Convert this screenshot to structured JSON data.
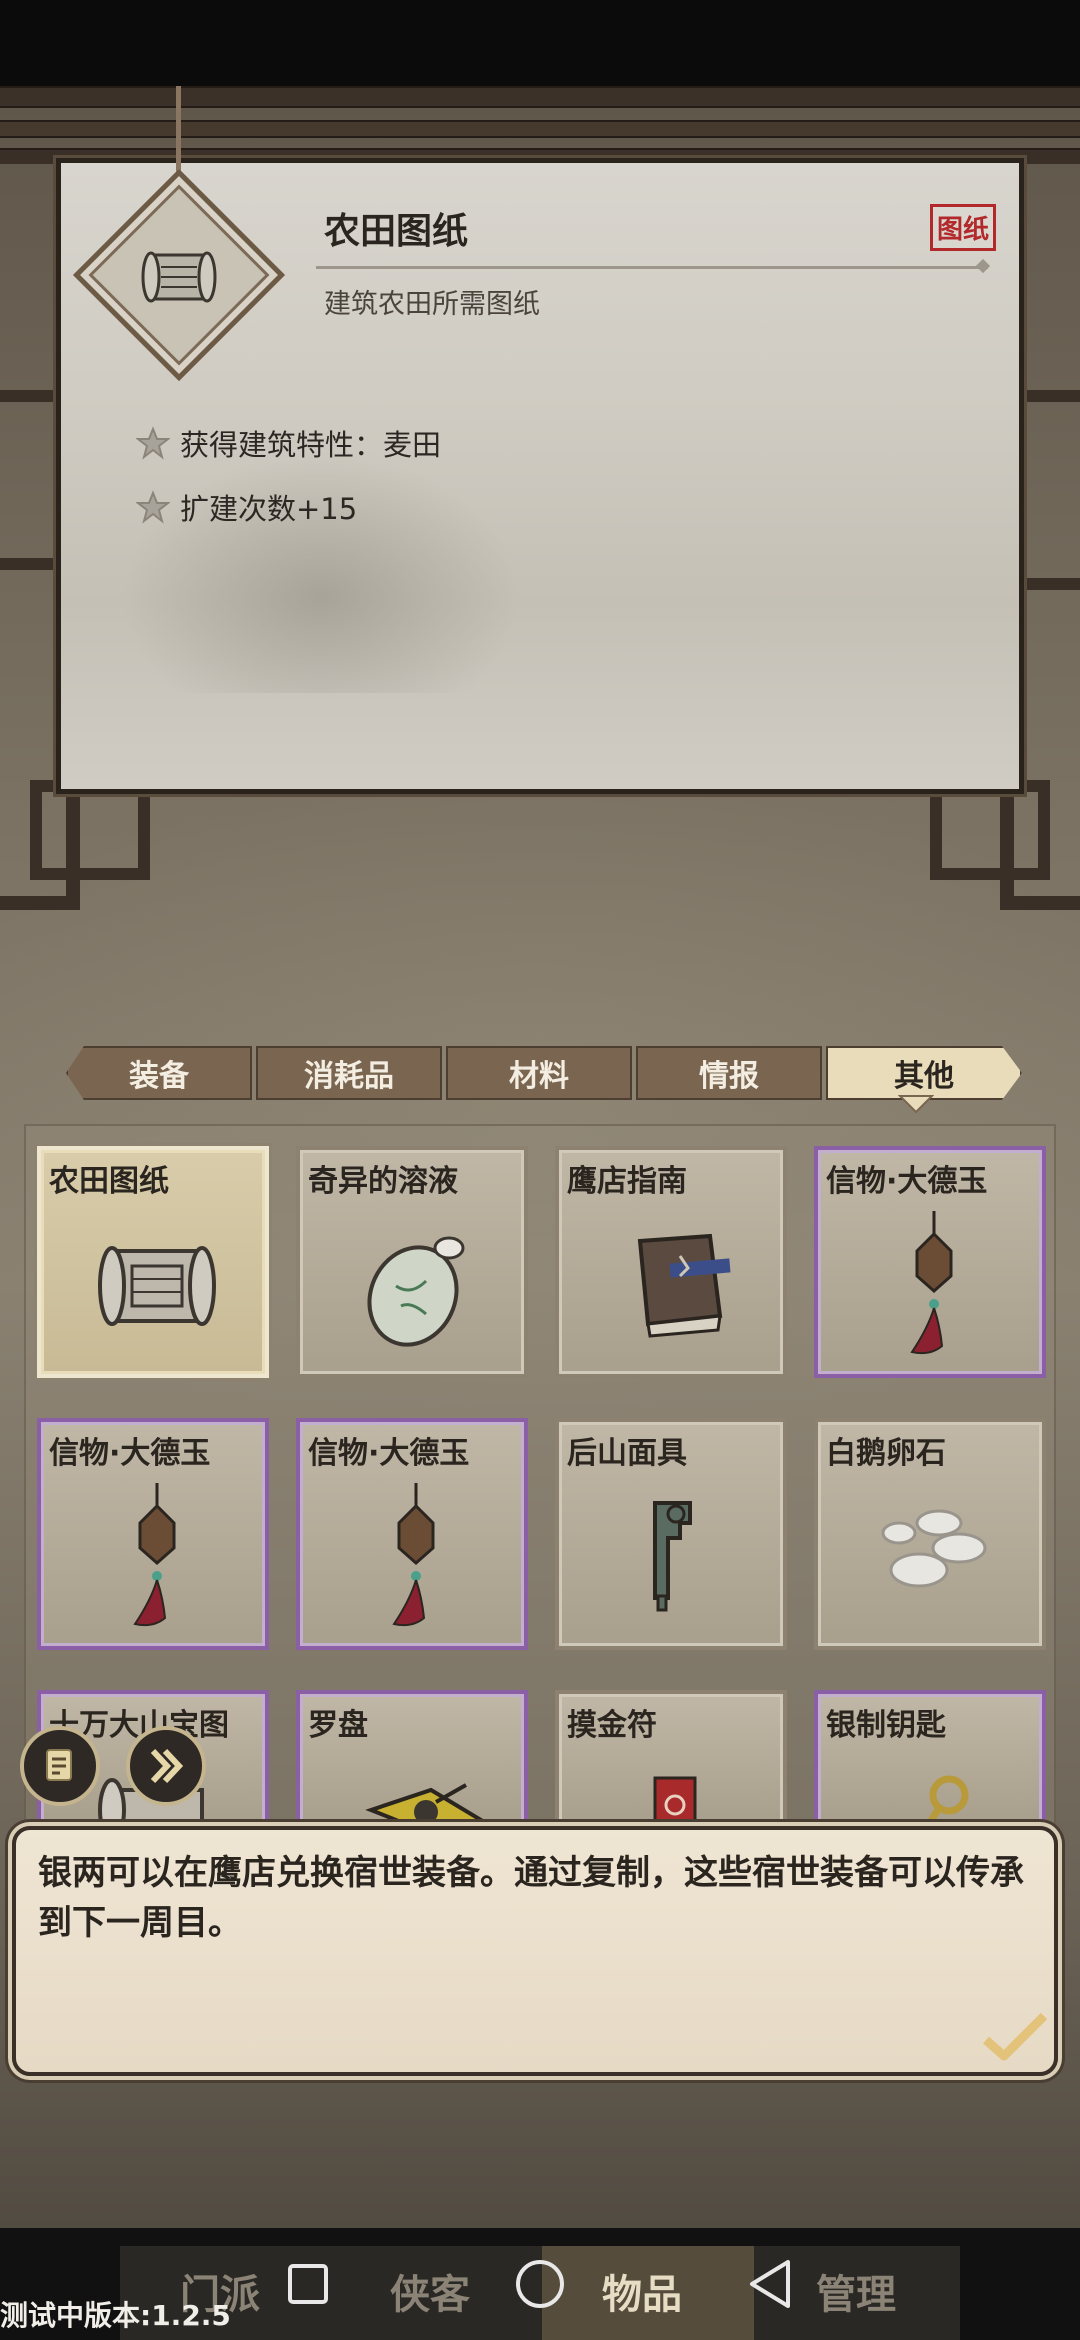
{
  "detail": {
    "name": "农田图纸",
    "type_tag": "图纸",
    "description": "建筑农田所需图纸",
    "properties": [
      "获得建筑特性：麦田",
      "扩建次数+15"
    ]
  },
  "tabs": [
    {
      "label": "装备",
      "active": false
    },
    {
      "label": "消耗品",
      "active": false
    },
    {
      "label": "材料",
      "active": false
    },
    {
      "label": "情报",
      "active": false
    },
    {
      "label": "其他",
      "active": true
    }
  ],
  "items": [
    {
      "name": "农田图纸",
      "icon": "scroll-icon",
      "rarity": "common",
      "selected": true
    },
    {
      "name": "奇异的溶液",
      "icon": "potion-icon",
      "rarity": "common"
    },
    {
      "name": "鹰店指南",
      "icon": "book-icon",
      "rarity": "common"
    },
    {
      "name": "信物·大德玉",
      "icon": "jade-pendant-icon",
      "rarity": "rare"
    },
    {
      "name": "信物·大德玉",
      "icon": "jade-pendant-icon",
      "rarity": "rare"
    },
    {
      "name": "信物·大德玉",
      "icon": "jade-pendant-icon",
      "rarity": "rare"
    },
    {
      "name": "后山面具",
      "icon": "mask-icon",
      "rarity": "common"
    },
    {
      "name": "白鹅卵石",
      "icon": "pebbles-icon",
      "rarity": "common"
    },
    {
      "name": "十万大山宝图",
      "icon": "scroll-icon",
      "rarity": "rare"
    },
    {
      "name": "罗盘",
      "icon": "compass-icon",
      "rarity": "rare"
    },
    {
      "name": "摸金符",
      "icon": "talisman-icon",
      "rarity": "common"
    },
    {
      "name": "银制钥匙",
      "icon": "key-icon",
      "rarity": "rare"
    }
  ],
  "dialog": {
    "text": "银两可以在鹰店兑换宿世装备。通过复制，这些宿世装备可以传承到下一周目。"
  },
  "bottom_nav": [
    {
      "label": "门派",
      "active": false
    },
    {
      "label": "侠客",
      "active": false
    },
    {
      "label": "物品",
      "active": true
    },
    {
      "label": "管理",
      "active": false
    }
  ],
  "version": "测试中版本:1.2.5",
  "colors": {
    "rare_border": "#8b5fa5",
    "tag_red": "#b3282a",
    "active_tab": "#e9dcba"
  }
}
